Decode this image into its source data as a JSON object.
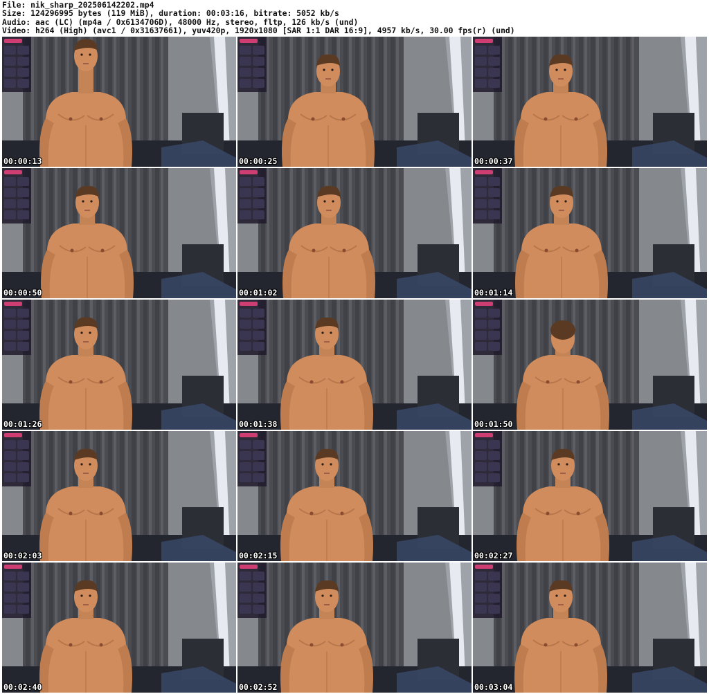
{
  "info": {
    "file": "File: nik_sharp_202506142202.mp4",
    "size": "Size: 124296995 bytes (119 MiB), duration: 00:03:16, bitrate: 5052 kb/s",
    "audio": "Audio: aac (LC) (mp4a / 0x6134706D), 48000 Hz, stereo, fltp, 126 kb/s (und)",
    "video": "Video: h264 (High) (avc1 / 0x31637661), yuv420p, 1920x1080 [SAR 1:1 DAR 16:9], 4957 kb/s, 30.00 fps(r) (und)"
  },
  "colors": {
    "background": "#ffffff",
    "wall": "#85888c",
    "curtain": "#4a4c51",
    "skin": "#d08c5c",
    "hair": "#5a3a22",
    "window_light": "#eef3f8",
    "bed": "#23262e",
    "overlay_panel": "#1e1a2a",
    "overlay_accent": "#e0407a"
  },
  "frames": [
    {
      "timestamp": "00:00:13"
    },
    {
      "timestamp": "00:00:25"
    },
    {
      "timestamp": "00:00:37"
    },
    {
      "timestamp": "00:00:50"
    },
    {
      "timestamp": "00:01:02"
    },
    {
      "timestamp": "00:01:14"
    },
    {
      "timestamp": "00:01:26"
    },
    {
      "timestamp": "00:01:38"
    },
    {
      "timestamp": "00:01:50"
    },
    {
      "timestamp": "00:02:03"
    },
    {
      "timestamp": "00:02:15"
    },
    {
      "timestamp": "00:02:27"
    },
    {
      "timestamp": "00:02:40"
    },
    {
      "timestamp": "00:02:52"
    },
    {
      "timestamp": "00:03:04"
    }
  ]
}
